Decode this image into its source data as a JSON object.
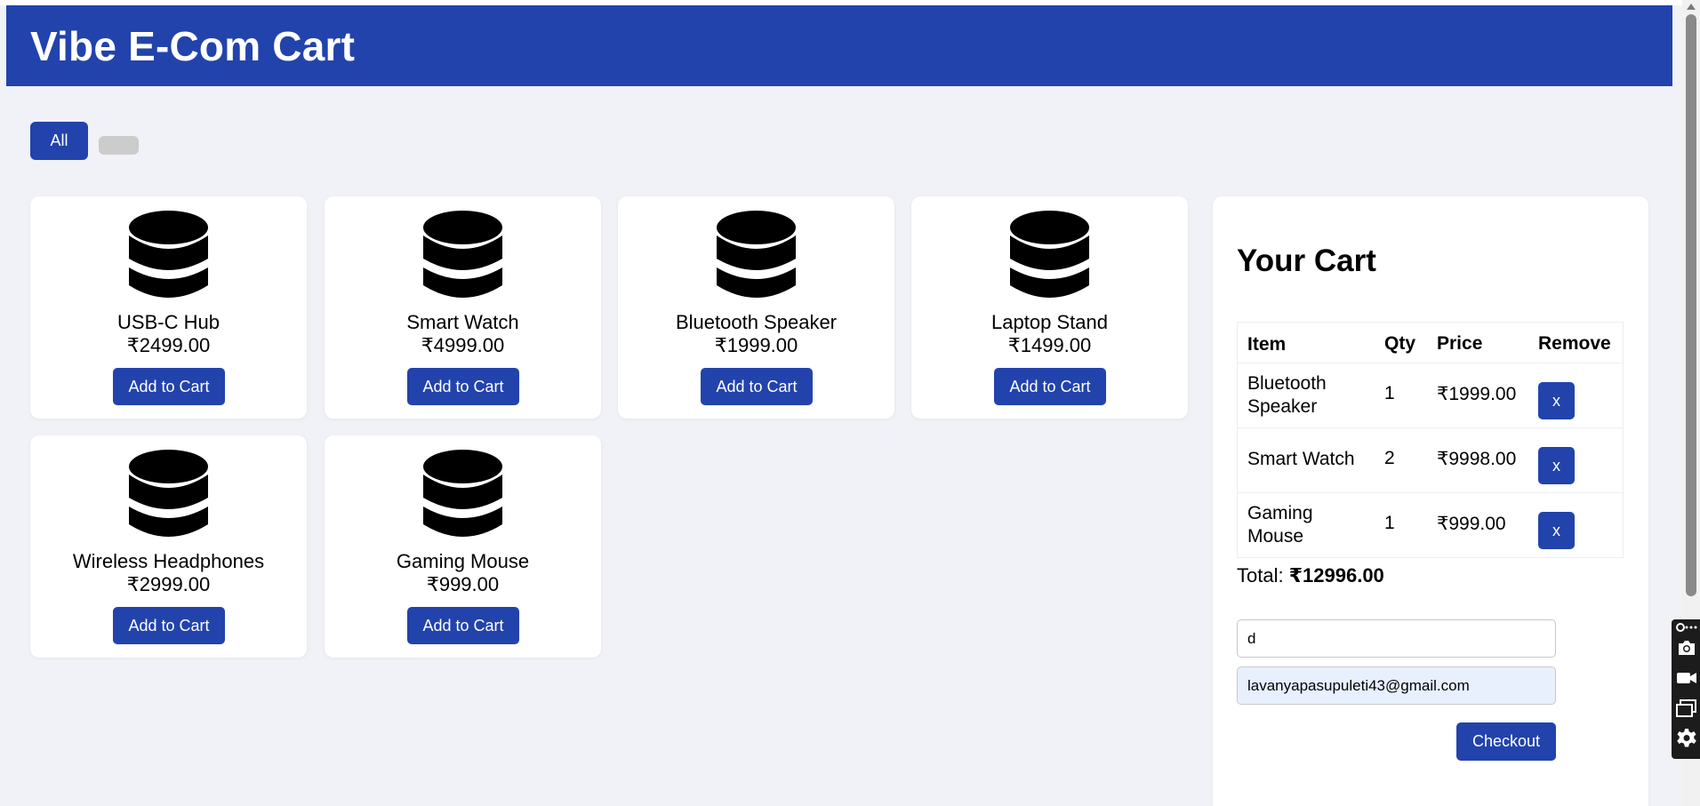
{
  "app": {
    "title": "Vibe E-Com Cart"
  },
  "filters": {
    "all_label": "All",
    "other_label": ""
  },
  "products": [
    {
      "name": "USB-C Hub",
      "price": "₹2499.00",
      "button": "Add to Cart",
      "icon": "database-icon"
    },
    {
      "name": "Smart Watch",
      "price": "₹4999.00",
      "button": "Add to Cart",
      "icon": "database-icon"
    },
    {
      "name": "Bluetooth Speaker",
      "price": "₹1999.00",
      "button": "Add to Cart",
      "icon": "database-icon"
    },
    {
      "name": "Laptop Stand",
      "price": "₹1499.00",
      "button": "Add to Cart",
      "icon": "database-icon"
    },
    {
      "name": "Wireless Headphones",
      "price": "₹2999.00",
      "button": "Add to Cart",
      "icon": "database-icon"
    },
    {
      "name": "Gaming Mouse",
      "price": "₹999.00",
      "button": "Add to Cart",
      "icon": "database-icon"
    }
  ],
  "cart": {
    "title": "Your Cart",
    "headers": {
      "item": "Item",
      "qty": "Qty",
      "price": "Price",
      "remove": "Remove"
    },
    "items": [
      {
        "name": "Bluetooth Speaker",
        "qty": "1",
        "price": "₹1999.00",
        "remove": "x"
      },
      {
        "name": "Smart Watch",
        "qty": "2",
        "price": "₹9998.00",
        "remove": "x"
      },
      {
        "name": "Gaming Mouse",
        "qty": "1",
        "price": "₹999.00",
        "remove": "x"
      }
    ],
    "total_label": "Total:",
    "total_value": "₹12996.00",
    "name_value": "d",
    "email_value": "lavanyapasupuleti43@gmail.com",
    "checkout_label": "Checkout"
  },
  "colors": {
    "accent": "#2243ac",
    "background": "#f1f2f7",
    "card": "#ffffff",
    "autofill": "#e8f0fe"
  },
  "toolbar_icons": [
    "link-icon",
    "camera-icon",
    "video-camera-icon",
    "windows-icon",
    "gear-icon"
  ]
}
